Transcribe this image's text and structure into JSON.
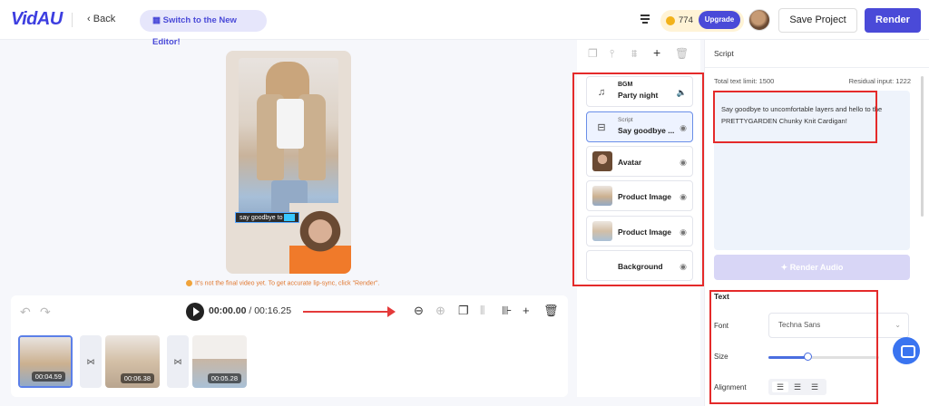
{
  "header": {
    "logo": "VidAU",
    "back_label": "Back",
    "switch_label": "Switch to the New Editor!",
    "credits": "774",
    "upgrade_label": "Upgrade",
    "save_label": "Save Project",
    "render_label": "Render"
  },
  "preview": {
    "caption_text": "say goodbye to",
    "notice": "It's not the final video yet. To get accurate lip-sync, click \"Render\"."
  },
  "timeline": {
    "current_time": "00:00.00",
    "total_time": "/ 00:16.25",
    "clips": [
      {
        "duration": "00:04.59"
      },
      {
        "duration": "00:06.38"
      },
      {
        "duration": "00:05.28"
      }
    ]
  },
  "layers": [
    {
      "type": "BGM",
      "title": "Party night",
      "icon": "music-note-icon",
      "toggle_icon": "volume-icon"
    },
    {
      "type": "Script",
      "title": "Say goodbye ...",
      "icon": "script-icon",
      "toggle_icon": "eye-icon",
      "selected": true
    },
    {
      "title": "Avatar",
      "icon": "avatar-thumb",
      "toggle_icon": "eye-icon"
    },
    {
      "title": "Product Image",
      "icon": "product-thumb",
      "toggle_icon": "eye-icon"
    },
    {
      "title": "Product Image",
      "icon": "product-thumb",
      "toggle_icon": "eye-icon"
    },
    {
      "title": "Background",
      "icon": "none",
      "toggle_icon": "eye-icon"
    }
  ],
  "script_panel": {
    "title": "Script",
    "total_limit": "Total text limit: 1500",
    "residual": "Residual input: 1222",
    "text": "Say goodbye to uncomfortable layers and hello to the PRETTYGARDEN Chunky Knit Cardigan!",
    "render_audio_label": "Render Audio"
  },
  "text_settings": {
    "section_label": "Text",
    "font_label": "Font",
    "font_value": "Techna Sans",
    "size_label": "Size",
    "size_level": 0.35,
    "alignment_label": "Alignment",
    "alignment": "left"
  },
  "colors": {
    "accent": "#4a4ad8",
    "highlight_box": "#e42a2a",
    "notice": "#e0772f"
  }
}
